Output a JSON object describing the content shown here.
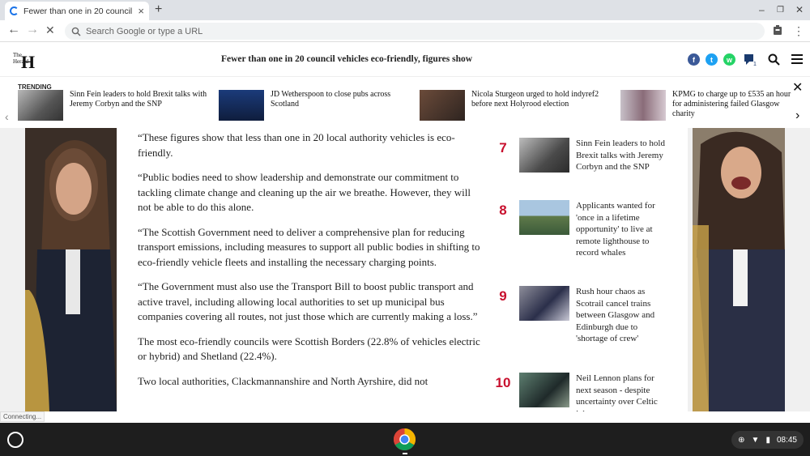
{
  "browser": {
    "tab_title": "Fewer than one in 20 council vehicles eco-friendly, figures show",
    "new_tab": "+",
    "omnibox_placeholder": "Search Google or type a URL"
  },
  "site": {
    "logo": "H",
    "logo_small": "The Herald",
    "headline": "Fewer than one in 20 council vehicles eco-friendly, figures show"
  },
  "trending": {
    "label": "TRENDING",
    "items": [
      {
        "title": "Sinn Fein leaders to hold Brexit talks with Jeremy Corbyn and the SNP"
      },
      {
        "title": "JD Wetherspoon to close pubs across Scotland"
      },
      {
        "title": "Nicola Sturgeon urged to hold indyref2 before next Holyrood election"
      },
      {
        "title": "KPMG to charge up to £535 an hour for administering failed Glasgow charity"
      }
    ]
  },
  "article": {
    "paragraphs": [
      "“These figures show that less than one in 20 local authority vehicles is eco-friendly.",
      "“Public bodies need to show leadership and demonstrate our commitment to tackling climate change and cleaning up the air we breathe. However, they will not be able to do this alone.",
      "“The Scottish Government need to deliver a comprehensive plan for reducing transport emissions, including measures to support all public bodies in shifting to eco-friendly vehicle fleets and installing the necessary charging points.",
      "“The Government must also use the Transport Bill to boost public transport and active travel, including allowing local authorities to set up municipal bus companies covering all routes, not just those which are currently making a loss.”",
      "The most eco-friendly councils were Scottish Borders (22.8% of vehicles electric or hybrid) and Shetland (22.4%).",
      "Two local authorities, Clackmannanshire and North Ayrshire, did not"
    ]
  },
  "popular": [
    {
      "num": "7",
      "title": "Sinn Fein leaders to hold Brexit talks with Jeremy Corbyn and the SNP"
    },
    {
      "num": "8",
      "title": "Applicants wanted for 'once in a lifetime opportunity' to live at remote lighthouse to record whales"
    },
    {
      "num": "9",
      "title": "Rush hour chaos as Scotrail cancel trains between Glasgow and Edinburgh due to 'shortage of crew'"
    },
    {
      "num": "10",
      "title": "Neil Lennon plans for next season - despite uncertainty over Celtic job"
    }
  ],
  "status": {
    "text": "Connecting..."
  },
  "shelf": {
    "time": "08:45"
  },
  "colors": {
    "accent_red": "#c8102e",
    "facebook": "#3b5998",
    "twitter": "#1da1f2",
    "whatsapp": "#25d366"
  }
}
